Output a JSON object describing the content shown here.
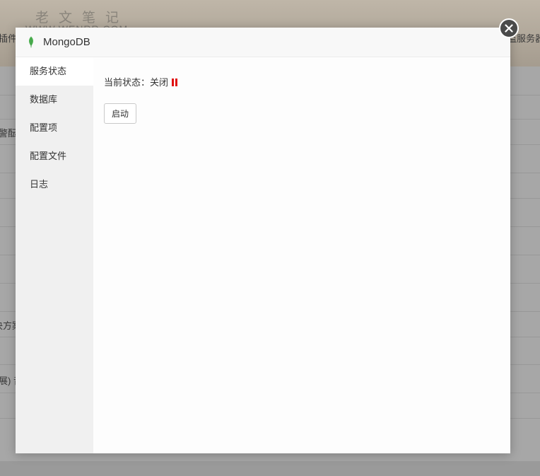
{
  "background": {
    "watermark_cn": "老文笔记",
    "watermark_en": "WWW.WENRR.COM",
    "fragments": [
      "插件",
      "警酝",
      "决方案",
      "展) 音",
      "监服务器"
    ]
  },
  "modal": {
    "title": "MongoDB",
    "icon": "mongodb-leaf-icon",
    "icon_color": "#4caf50",
    "close_icon": "close-icon",
    "sidebar": {
      "items": [
        {
          "label": "服务状态",
          "active": true
        },
        {
          "label": "数据库",
          "active": false
        },
        {
          "label": "配置项",
          "active": false
        },
        {
          "label": "配置文件",
          "active": false
        },
        {
          "label": "日志",
          "active": false
        }
      ]
    },
    "content": {
      "status_label": "当前状态：关闭",
      "status_icon": "pause-icon",
      "status_color": "#e01010",
      "start_button": "启动"
    }
  }
}
